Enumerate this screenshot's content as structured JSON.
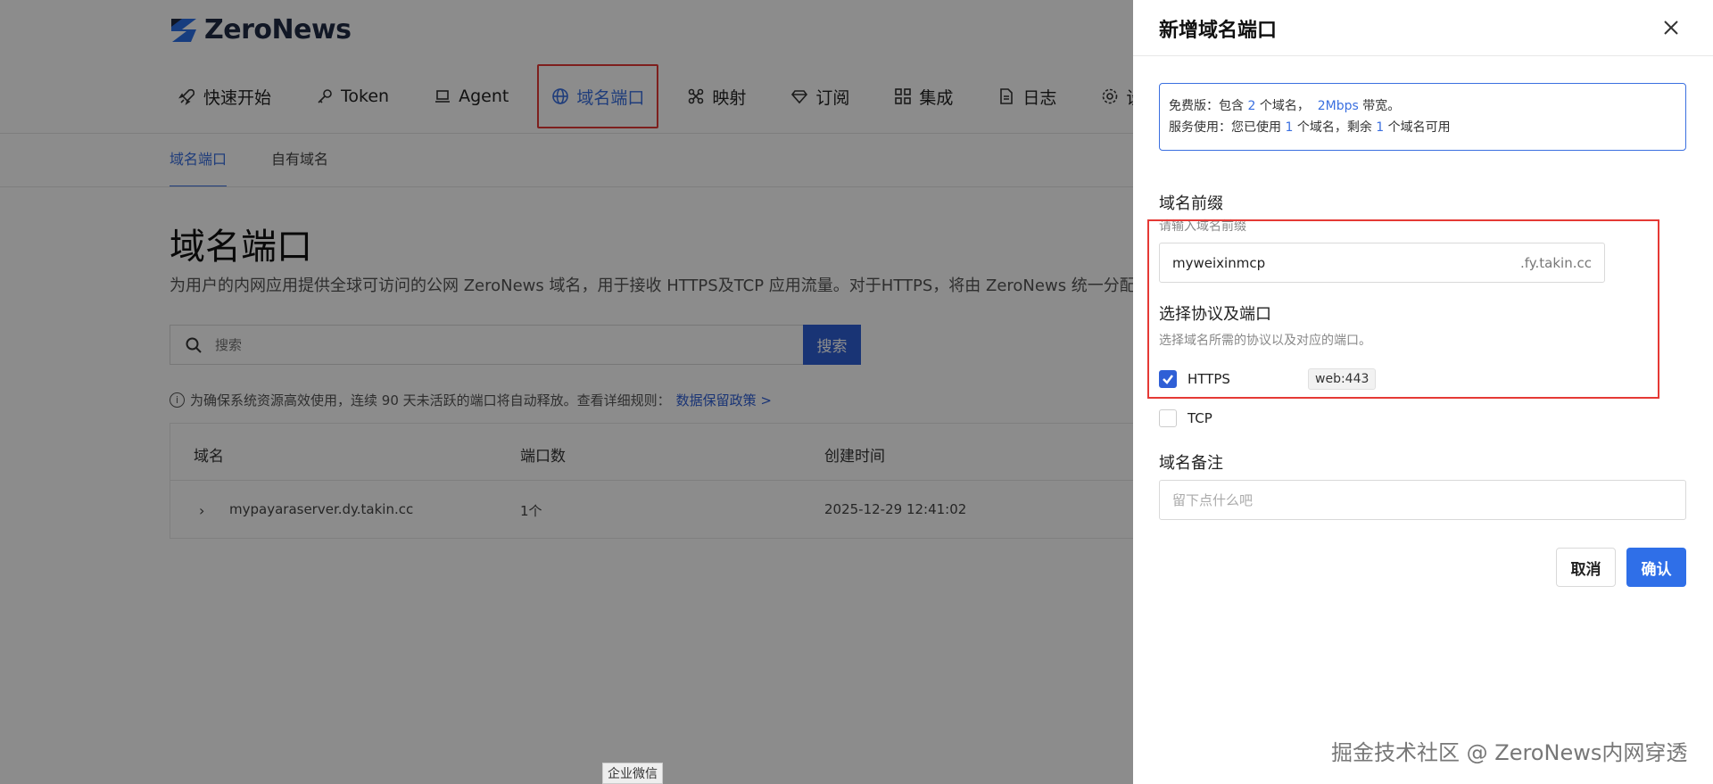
{
  "brand": {
    "name": "ZeroNews"
  },
  "nav": {
    "items": [
      {
        "label": "快速开始",
        "icon": "rocket-icon"
      },
      {
        "label": "Token",
        "icon": "key-icon"
      },
      {
        "label": "Agent",
        "icon": "laptop-icon"
      },
      {
        "label": "域名端口",
        "icon": "globe-icon",
        "active": true
      },
      {
        "label": "映射",
        "icon": "network-icon"
      },
      {
        "label": "订阅",
        "icon": "diamond-icon"
      },
      {
        "label": "集成",
        "icon": "grid-icon"
      },
      {
        "label": "日志",
        "icon": "document-icon"
      },
      {
        "label": "设置",
        "icon": "gear-icon"
      }
    ]
  },
  "subtabs": [
    {
      "label": "域名端口",
      "active": true
    },
    {
      "label": "自有域名",
      "active": false
    }
  ],
  "main": {
    "title": "域名端口",
    "description": "为用户的内网应用提供全球可访问的公网 ZeroNews 域名，用于接收 HTTPS及TCP 应用流量。对于HTTPS，将由 ZeroNews 统一分配 TLS 证",
    "search": {
      "placeholder": "搜索",
      "button": "搜索"
    },
    "notice": {
      "text": "为确保系统资源高效使用，连续 90 天未活跃的端口将自动释放。查看详细规则：",
      "link": "数据保留政策 >"
    },
    "table": {
      "columns": [
        "域名",
        "端口数",
        "创建时间"
      ],
      "rows": [
        {
          "domain": "mypayaraserver.dy.takin.cc",
          "ports": "1个",
          "created": "2025-12-29 12:41:02"
        }
      ]
    }
  },
  "wx_tag": "企业微信",
  "drawer": {
    "title": "新增域名端口",
    "quota": {
      "line1_prefix": "免费版：包含",
      "domains": "2",
      "line1_mid": "个域名，",
      "bandwidth": "2Mbps",
      "line1_suffix": "带宽。",
      "line2_prefix": "服务使用：您已使用",
      "used": "1",
      "line2_mid": "个域名，剩余",
      "remaining": "1",
      "line2_suffix": "个域名可用"
    },
    "prefix": {
      "label": "域名前缀",
      "hint": "请输入域名前缀",
      "value": "myweixinmcp",
      "suffix": ".fy.takin.cc"
    },
    "protocol": {
      "label": "选择协议及端口",
      "hint": "选择域名所需的协议以及对应的端口。",
      "options": [
        {
          "label": "HTTPS",
          "checked": true,
          "tag": "web:443"
        },
        {
          "label": "TCP",
          "checked": false
        }
      ]
    },
    "remark": {
      "label": "域名备注",
      "placeholder": "留下点什么吧"
    },
    "buttons": {
      "cancel": "取消",
      "confirm": "确认"
    }
  },
  "watermark": "掘金技术社区 @ ZeroNews内网穿透",
  "colors": {
    "accent": "#2f5fd6",
    "highlight": "#e53935"
  }
}
